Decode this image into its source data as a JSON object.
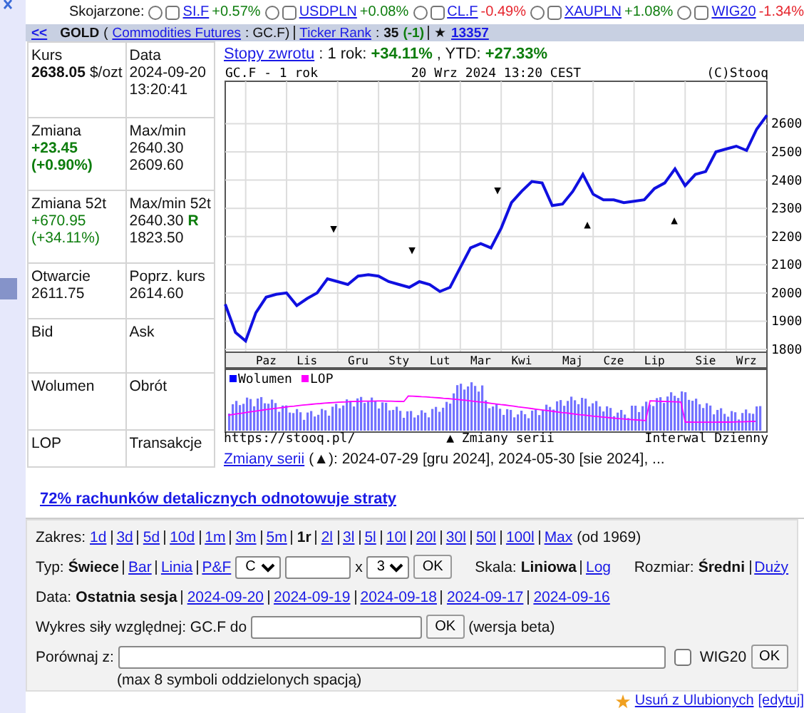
{
  "related": {
    "label": "Skojarzone:",
    "items": [
      {
        "symbol": "SI.F",
        "change": "+0.57%",
        "color": "#0d7d0d",
        "selected": false,
        "checked": false
      },
      {
        "symbol": "USDPLN",
        "change": "+0.08%",
        "color": "#0d7d0d",
        "selected": false,
        "checked": false
      },
      {
        "symbol": "CL.F",
        "change": "-0.49%",
        "color": "#e6262e",
        "selected": false,
        "checked": false
      },
      {
        "symbol": "XAUPLN",
        "change": "+1.08%",
        "color": "#0d7d0d",
        "selected": false,
        "checked": false
      },
      {
        "symbol": "WIG20",
        "change": "-1.34%",
        "color": "#e6262e",
        "selected": false,
        "checked": false
      }
    ]
  },
  "header": {
    "back": "<<",
    "segments": [
      {
        "kind": "bold",
        "text": "GOLD"
      },
      {
        "kind": "text",
        "text": "("
      },
      {
        "kind": "link",
        "text": "Commodities Futures"
      },
      {
        "kind": "text",
        "text": ": GC.F)"
      },
      {
        "kind": "divider"
      },
      {
        "kind": "link",
        "text": "Ticker Rank"
      },
      {
        "kind": "text",
        "text": ":"
      },
      {
        "kind": "bold",
        "text": "35"
      },
      {
        "kind": "greenbold",
        "text": "(-1)"
      },
      {
        "kind": "divider"
      },
      {
        "kind": "text",
        "text": "★"
      },
      {
        "kind": "linkbold",
        "text": "13357"
      }
    ]
  },
  "quote_table": {
    "rows": [
      [
        {
          "label": "Kurs",
          "lines": [
            [
              {
                "kind": "bold",
                "text": "2638.05"
              },
              {
                "kind": "text",
                "text": "$/ozt"
              }
            ]
          ]
        },
        {
          "label": "Data",
          "lines": [
            [
              {
                "kind": "text",
                "text": "2024-09-20"
              }
            ],
            [
              {
                "kind": "text",
                "text": "13:20:41"
              }
            ]
          ]
        }
      ],
      [
        {
          "label": "Zmiana",
          "lines": [
            [
              {
                "kind": "greenbold",
                "text": "+23.45"
              }
            ],
            [
              {
                "kind": "greenbold",
                "text": "(+0.90%)"
              }
            ]
          ]
        },
        {
          "label": "Max/min",
          "lines": [
            [
              {
                "kind": "text",
                "text": "2640.30"
              }
            ],
            [
              {
                "kind": "text",
                "text": "2609.60"
              }
            ]
          ]
        }
      ],
      [
        {
          "label": "Zmiana 52t",
          "lines": [
            [
              {
                "kind": "green",
                "text": "+670.95"
              }
            ],
            [
              {
                "kind": "green",
                "text": "(+34.11%)"
              }
            ]
          ]
        },
        {
          "label": "Max/min 52t",
          "lines": [
            [
              {
                "kind": "text",
                "text": "2640.30"
              },
              {
                "kind": "greenbold",
                "text": "R"
              }
            ],
            [
              {
                "kind": "text",
                "text": "1823.50"
              }
            ]
          ]
        }
      ],
      [
        {
          "label": "Otwarcie",
          "lines": [
            [
              {
                "kind": "text",
                "text": "2611.75"
              }
            ]
          ]
        },
        {
          "label": "Poprz. kurs",
          "lines": [
            [
              {
                "kind": "text",
                "text": "2614.60"
              }
            ]
          ]
        }
      ],
      [
        {
          "label": "Bid"
        },
        {
          "label": "Ask"
        }
      ],
      [
        {
          "label": "Wolumen"
        },
        {
          "label": "Obrót"
        }
      ],
      [
        {
          "label": "LOP"
        },
        {
          "label": "Transakcje"
        }
      ]
    ]
  },
  "returns": [
    {
      "kind": "link",
      "text": "Stopy zwrotu"
    },
    {
      "kind": "text",
      "text": ": 1 rok:"
    },
    {
      "kind": "greenbold",
      "text": "+34.11%"
    },
    {
      "kind": "text",
      "text": ", YTD:"
    },
    {
      "kind": "greenbold",
      "text": "+27.33%"
    }
  ],
  "chart": {
    "title": "GC.F - 1 rok",
    "timestamp": "20 Wrz 2024 13:20 CEST",
    "copyright": "(C)Stooq",
    "chart_data": {
      "type": "line",
      "ylim": [
        1790,
        2750
      ],
      "categories": [
        null,
        null,
        null,
        null,
        "Paz",
        null,
        null,
        null,
        "Lis",
        null,
        null,
        null,
        null,
        "Gru",
        null,
        null,
        null,
        "Sty",
        null,
        null,
        null,
        "Lut",
        null,
        null,
        null,
        "Mar",
        null,
        null,
        null,
        "Kwi",
        null,
        null,
        null,
        null,
        "Maj",
        null,
        null,
        null,
        "Cze",
        null,
        null,
        null,
        "Lip",
        null,
        null,
        null,
        null,
        "Sie",
        null,
        null,
        null,
        "Wrz",
        null,
        null
      ],
      "series": [
        {
          "color": "#1010e0",
          "values": [
            1960,
            1860,
            1830,
            1930,
            1985,
            1995,
            2000,
            1955,
            1980,
            2000,
            2050,
            2040,
            2030,
            2060,
            2065,
            2060,
            2040,
            2030,
            2020,
            2040,
            2030,
            2005,
            2020,
            2090,
            2160,
            2175,
            2160,
            2230,
            2320,
            2360,
            2395,
            2390,
            2310,
            2315,
            2360,
            2420,
            2350,
            2330,
            2330,
            2320,
            2325,
            2330,
            2370,
            2390,
            2440,
            2380,
            2420,
            2430,
            2500,
            2510,
            2520,
            2505,
            2580,
            2630
          ]
        }
      ],
      "yticks": [
        1800,
        1900,
        2000,
        2100,
        2200,
        2300,
        2400,
        2500,
        2600
      ],
      "grid": true,
      "annotations": [
        "▼",
        "▼",
        "▼",
        "▲",
        "▲"
      ]
    },
    "volume_legend": [
      {
        "label": "Wolumen",
        "color": "#0000ff"
      },
      {
        "label": "LOP",
        "color": "#ff00ff"
      }
    ],
    "source": "https://stooq.pl/",
    "marker_legend": "▲ Zmiany serii",
    "interval": "Interwal Dzienny"
  },
  "series_changes": [
    {
      "kind": "link",
      "text": "Zmiany serii"
    },
    {
      "kind": "text",
      "text": "(▲): 2024-07-29 [gru 2024], 2024-05-30 [sie 2024], ..."
    }
  ],
  "risk_notice": "72% rachunków detalicznych odnotowuje straty",
  "controls": {
    "range": {
      "label": "Zakres:",
      "options": [
        {
          "label": "1d",
          "selected": false
        },
        {
          "label": "3d",
          "selected": false
        },
        {
          "label": "5d",
          "selected": false
        },
        {
          "label": "10d",
          "selected": false
        },
        {
          "label": "1m",
          "selected": false
        },
        {
          "label": "3m",
          "selected": false
        },
        {
          "label": "5m",
          "selected": false
        },
        {
          "label": "1r",
          "selected": true
        },
        {
          "label": "2l",
          "selected": false
        },
        {
          "label": "3l",
          "selected": false
        },
        {
          "label": "5l",
          "selected": false
        },
        {
          "label": "10l",
          "selected": false
        },
        {
          "label": "20l",
          "selected": false
        },
        {
          "label": "30l",
          "selected": false
        },
        {
          "label": "50l",
          "selected": false
        },
        {
          "label": "100l",
          "selected": false
        },
        {
          "label": "Max",
          "selected": false
        }
      ],
      "note": "(od 1969)"
    },
    "type": {
      "label": "Typ:",
      "options": [
        {
          "label": "Świece",
          "selected": true
        },
        {
          "label": "Bar",
          "selected": false
        },
        {
          "label": "Linia",
          "selected": false
        },
        {
          "label": "P&F",
          "selected": false
        }
      ],
      "select_1": "C",
      "times": "x",
      "select_2": "3",
      "button": "OK"
    },
    "scale": {
      "label": "Skala:",
      "options": [
        {
          "label": "Liniowa",
          "selected": true
        },
        {
          "label": "Log",
          "selected": false
        }
      ]
    },
    "size": {
      "label": "Rozmiar:",
      "options": [
        {
          "label": "Średni",
          "selected": true
        },
        {
          "label": "Duży",
          "selected": false
        }
      ]
    },
    "date": {
      "label": "Data:",
      "options": [
        {
          "label": "Ostatnia sesja",
          "selected": true
        },
        {
          "label": "2024-09-20",
          "selected": false
        },
        {
          "label": "2024-09-19",
          "selected": false
        },
        {
          "label": "2024-09-18",
          "selected": false
        },
        {
          "label": "2024-09-17",
          "selected": false
        },
        {
          "label": "2024-09-16",
          "selected": false
        }
      ]
    },
    "relative": {
      "label": "Wykres siły względnej: GC.F do",
      "button": "OK",
      "note": "(wersja beta)"
    },
    "compare": {
      "label": "Porównaj z:",
      "checkbox_label": "WIG20",
      "checked": false,
      "button": "OK",
      "hint": "(max 8 symboli oddzielonych spacją)"
    }
  },
  "favorites": {
    "remove": "Usuń z Ulubionych",
    "edit": "[edytuj]"
  }
}
